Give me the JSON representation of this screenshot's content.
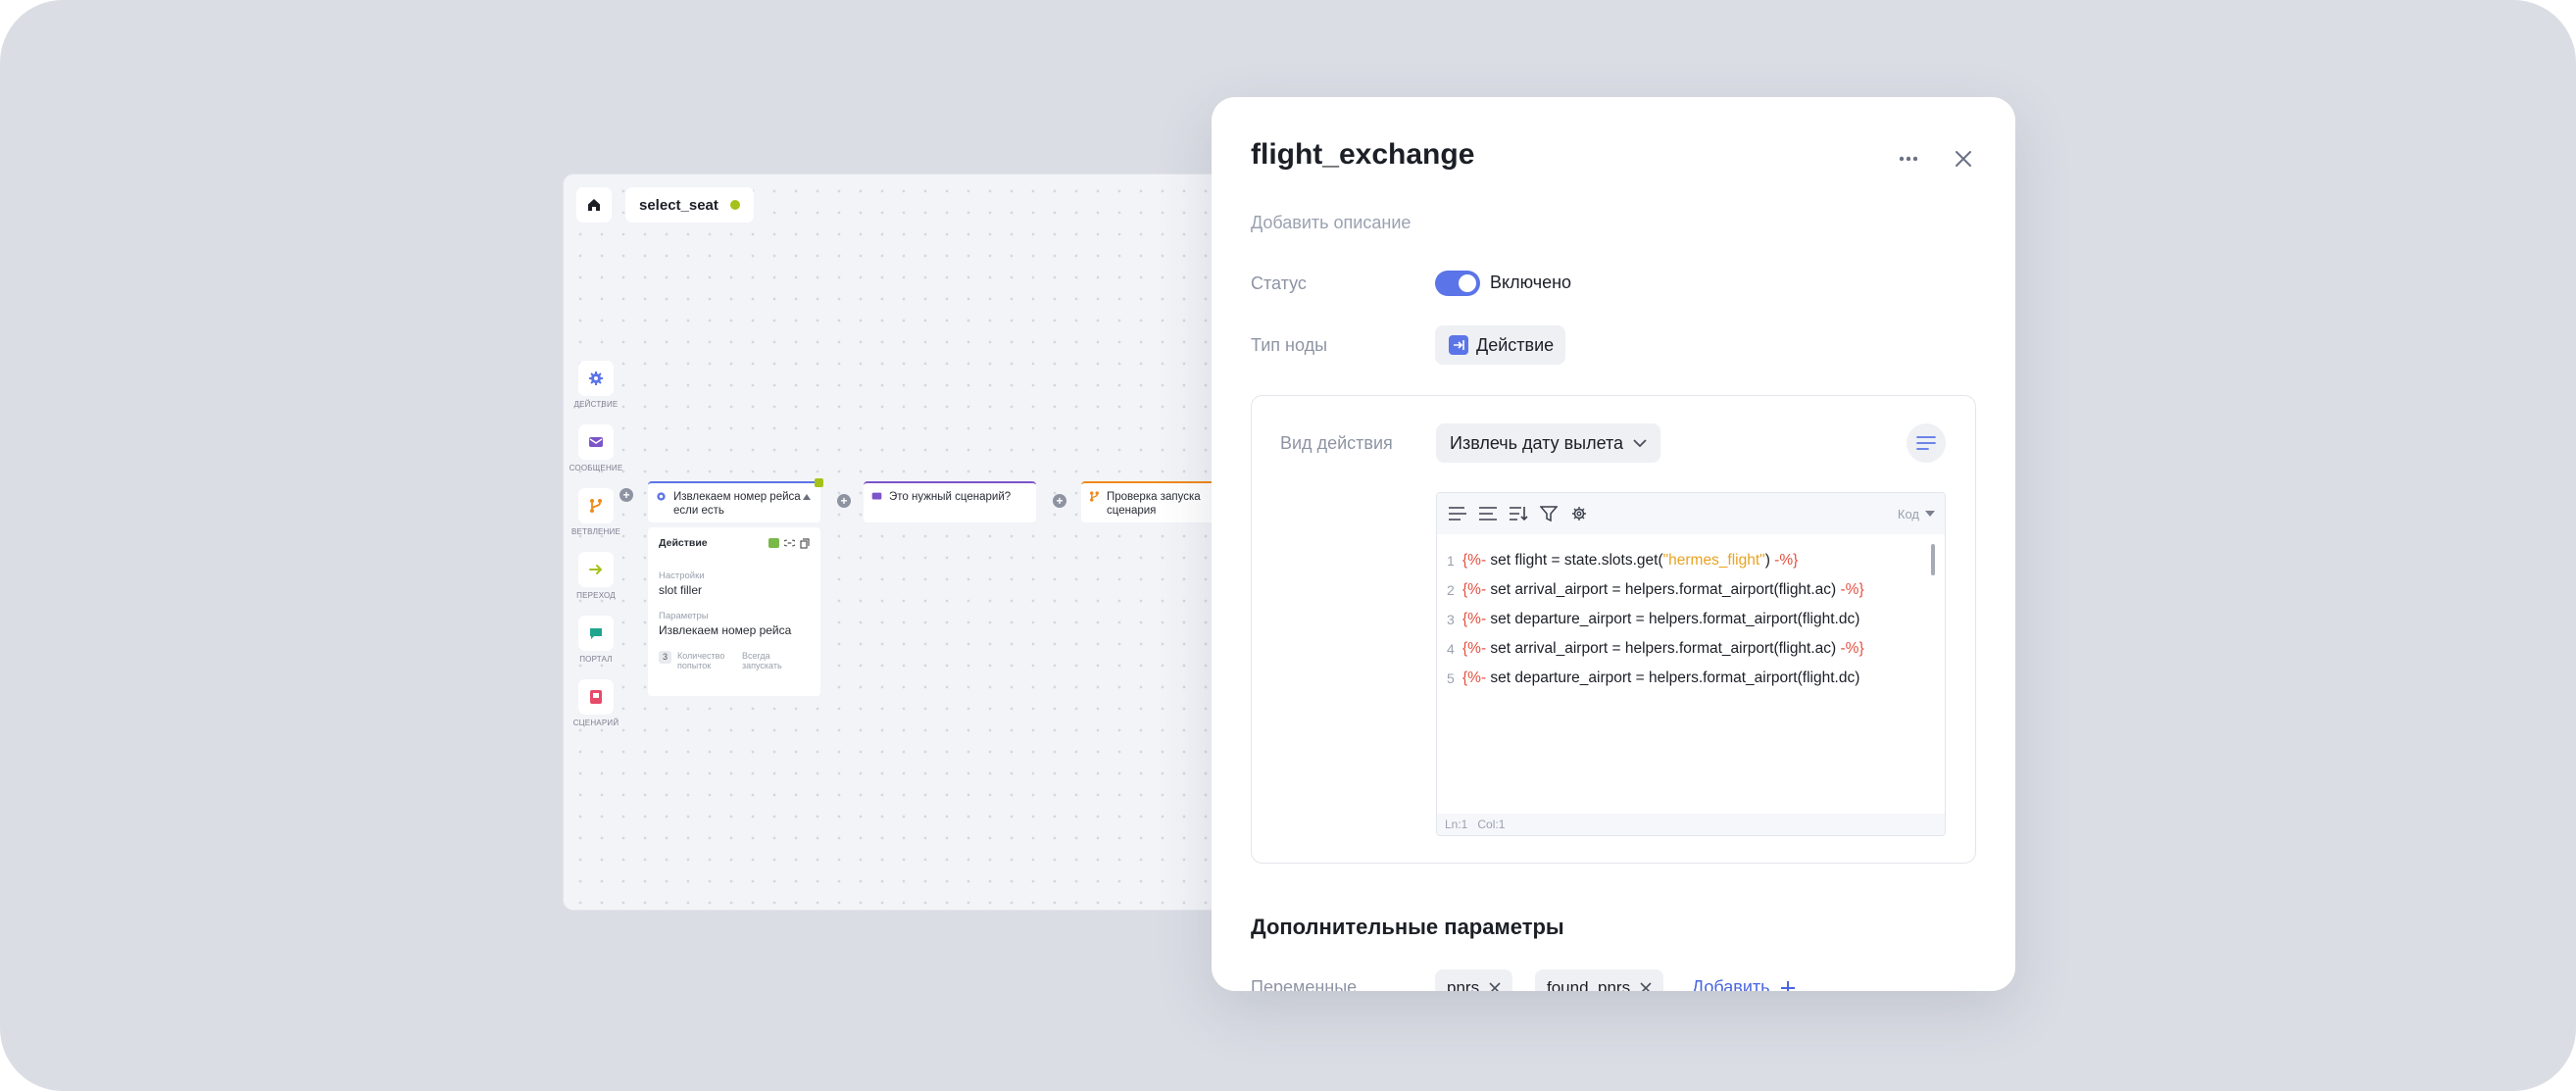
{
  "canvas": {
    "breadcrumb": "select_seat",
    "palette": [
      {
        "label": "ДЕЙСТВИЕ",
        "icon": "gear-icon",
        "color": "#5b74e8"
      },
      {
        "label": "СООБЩЕНИЕ",
        "icon": "envelope-icon",
        "color": "#7b55c9"
      },
      {
        "label": "ВЕТВЛЕНИЕ",
        "icon": "branch-icon",
        "color": "#ef8a1c"
      },
      {
        "label": "ПЕРЕХОД",
        "icon": "arrow-right-icon",
        "color": "#a4c21a"
      },
      {
        "label": "ПОРТАЛ",
        "icon": "chat-icon",
        "color": "#21a58f"
      },
      {
        "label": "СЦЕНАРИЙ",
        "icon": "scenario-icon",
        "color": "#e84a6a"
      }
    ],
    "nodes": {
      "action": "Извлекаем номер рейса если есть",
      "message": "Это нужный сценарий?",
      "branch": "Проверка запуска сценария"
    },
    "detail": {
      "title": "Действие",
      "settings_label": "Настройки",
      "settings_value": "slot filler",
      "params_label": "Параметры",
      "params_value": "Извлекаем номер рейса",
      "attempts_count": "3",
      "attempts_label": "Количество попыток",
      "always_run": "Всегда запускать"
    }
  },
  "dialog": {
    "title": "flight_exchange",
    "description_placeholder": "Добавить описание",
    "status_label": "Статус",
    "status_value": "Включено",
    "status_on": true,
    "node_type_label": "Тип ноды",
    "node_type_value": "Действие",
    "action_type_label": "Вид действия",
    "action_type_value": "Извлечь дату вылета",
    "editor": {
      "mode": "Код",
      "lines": [
        {
          "n": "1",
          "open": "{%-",
          "body": " set flight = state.slots.get(",
          "str": "\"hermes_flight\"",
          "tail": ") ",
          "close": "-%}"
        },
        {
          "n": "2",
          "open": "{%-",
          "body": " set arrival_airport = helpers.format_airport(flight.ac) ",
          "str": "",
          "tail": "",
          "close": "-%}"
        },
        {
          "n": "3",
          "open": "{%-",
          "body": " set departure_airport = helpers.format_airport(flight.dc)",
          "str": "",
          "tail": "",
          "close": ""
        },
        {
          "n": "4",
          "open": "{%-",
          "body": " set arrival_airport = helpers.format_airport(flight.ac) ",
          "str": "",
          "tail": "",
          "close": "-%}"
        },
        {
          "n": "5",
          "open": "{%-",
          "body": " set departure_airport = helpers.format_airport(flight.dc)",
          "str": "",
          "tail": "",
          "close": ""
        }
      ],
      "status_ln": "Ln:1",
      "status_col": "Col:1"
    },
    "extra_title": "Дополнительные параметры",
    "variables_label": "Переменные",
    "variables": [
      "pnrs",
      "found_pnrs"
    ],
    "add_label": "Добавить"
  }
}
